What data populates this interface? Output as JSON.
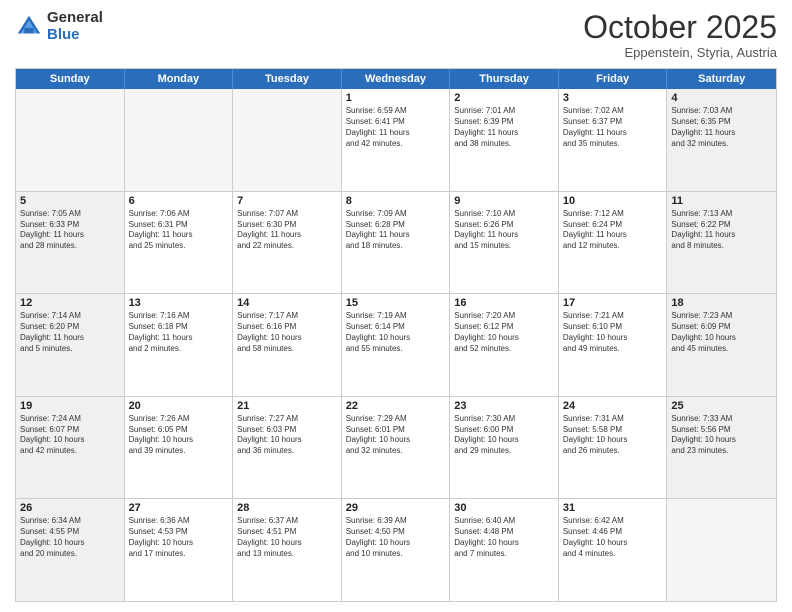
{
  "logo": {
    "general": "General",
    "blue": "Blue"
  },
  "header": {
    "month": "October 2025",
    "location": "Eppenstein, Styria, Austria"
  },
  "days": [
    "Sunday",
    "Monday",
    "Tuesday",
    "Wednesday",
    "Thursday",
    "Friday",
    "Saturday"
  ],
  "weeks": [
    [
      {
        "num": "",
        "text": "",
        "empty": true
      },
      {
        "num": "",
        "text": "",
        "empty": true
      },
      {
        "num": "",
        "text": "",
        "empty": true
      },
      {
        "num": "1",
        "text": "Sunrise: 6:59 AM\nSunset: 6:41 PM\nDaylight: 11 hours\nand 42 minutes.",
        "empty": false
      },
      {
        "num": "2",
        "text": "Sunrise: 7:01 AM\nSunset: 6:39 PM\nDaylight: 11 hours\nand 38 minutes.",
        "empty": false
      },
      {
        "num": "3",
        "text": "Sunrise: 7:02 AM\nSunset: 6:37 PM\nDaylight: 11 hours\nand 35 minutes.",
        "empty": false
      },
      {
        "num": "4",
        "text": "Sunrise: 7:03 AM\nSunset: 6:35 PM\nDaylight: 11 hours\nand 32 minutes.",
        "empty": false,
        "shaded": true
      }
    ],
    [
      {
        "num": "5",
        "text": "Sunrise: 7:05 AM\nSunset: 6:33 PM\nDaylight: 11 hours\nand 28 minutes.",
        "empty": false,
        "shaded": true
      },
      {
        "num": "6",
        "text": "Sunrise: 7:06 AM\nSunset: 6:31 PM\nDaylight: 11 hours\nand 25 minutes.",
        "empty": false
      },
      {
        "num": "7",
        "text": "Sunrise: 7:07 AM\nSunset: 6:30 PM\nDaylight: 11 hours\nand 22 minutes.",
        "empty": false
      },
      {
        "num": "8",
        "text": "Sunrise: 7:09 AM\nSunset: 6:28 PM\nDaylight: 11 hours\nand 18 minutes.",
        "empty": false
      },
      {
        "num": "9",
        "text": "Sunrise: 7:10 AM\nSunset: 6:26 PM\nDaylight: 11 hours\nand 15 minutes.",
        "empty": false
      },
      {
        "num": "10",
        "text": "Sunrise: 7:12 AM\nSunset: 6:24 PM\nDaylight: 11 hours\nand 12 minutes.",
        "empty": false
      },
      {
        "num": "11",
        "text": "Sunrise: 7:13 AM\nSunset: 6:22 PM\nDaylight: 11 hours\nand 8 minutes.",
        "empty": false,
        "shaded": true
      }
    ],
    [
      {
        "num": "12",
        "text": "Sunrise: 7:14 AM\nSunset: 6:20 PM\nDaylight: 11 hours\nand 5 minutes.",
        "empty": false,
        "shaded": true
      },
      {
        "num": "13",
        "text": "Sunrise: 7:16 AM\nSunset: 6:18 PM\nDaylight: 11 hours\nand 2 minutes.",
        "empty": false
      },
      {
        "num": "14",
        "text": "Sunrise: 7:17 AM\nSunset: 6:16 PM\nDaylight: 10 hours\nand 58 minutes.",
        "empty": false
      },
      {
        "num": "15",
        "text": "Sunrise: 7:19 AM\nSunset: 6:14 PM\nDaylight: 10 hours\nand 55 minutes.",
        "empty": false
      },
      {
        "num": "16",
        "text": "Sunrise: 7:20 AM\nSunset: 6:12 PM\nDaylight: 10 hours\nand 52 minutes.",
        "empty": false
      },
      {
        "num": "17",
        "text": "Sunrise: 7:21 AM\nSunset: 6:10 PM\nDaylight: 10 hours\nand 49 minutes.",
        "empty": false
      },
      {
        "num": "18",
        "text": "Sunrise: 7:23 AM\nSunset: 6:09 PM\nDaylight: 10 hours\nand 45 minutes.",
        "empty": false,
        "shaded": true
      }
    ],
    [
      {
        "num": "19",
        "text": "Sunrise: 7:24 AM\nSunset: 6:07 PM\nDaylight: 10 hours\nand 42 minutes.",
        "empty": false,
        "shaded": true
      },
      {
        "num": "20",
        "text": "Sunrise: 7:26 AM\nSunset: 6:05 PM\nDaylight: 10 hours\nand 39 minutes.",
        "empty": false
      },
      {
        "num": "21",
        "text": "Sunrise: 7:27 AM\nSunset: 6:03 PM\nDaylight: 10 hours\nand 36 minutes.",
        "empty": false
      },
      {
        "num": "22",
        "text": "Sunrise: 7:29 AM\nSunset: 6:01 PM\nDaylight: 10 hours\nand 32 minutes.",
        "empty": false
      },
      {
        "num": "23",
        "text": "Sunrise: 7:30 AM\nSunset: 6:00 PM\nDaylight: 10 hours\nand 29 minutes.",
        "empty": false
      },
      {
        "num": "24",
        "text": "Sunrise: 7:31 AM\nSunset: 5:58 PM\nDaylight: 10 hours\nand 26 minutes.",
        "empty": false
      },
      {
        "num": "25",
        "text": "Sunrise: 7:33 AM\nSunset: 5:56 PM\nDaylight: 10 hours\nand 23 minutes.",
        "empty": false,
        "shaded": true
      }
    ],
    [
      {
        "num": "26",
        "text": "Sunrise: 6:34 AM\nSunset: 4:55 PM\nDaylight: 10 hours\nand 20 minutes.",
        "empty": false,
        "shaded": true
      },
      {
        "num": "27",
        "text": "Sunrise: 6:36 AM\nSunset: 4:53 PM\nDaylight: 10 hours\nand 17 minutes.",
        "empty": false
      },
      {
        "num": "28",
        "text": "Sunrise: 6:37 AM\nSunset: 4:51 PM\nDaylight: 10 hours\nand 13 minutes.",
        "empty": false
      },
      {
        "num": "29",
        "text": "Sunrise: 6:39 AM\nSunset: 4:50 PM\nDaylight: 10 hours\nand 10 minutes.",
        "empty": false
      },
      {
        "num": "30",
        "text": "Sunrise: 6:40 AM\nSunset: 4:48 PM\nDaylight: 10 hours\nand 7 minutes.",
        "empty": false
      },
      {
        "num": "31",
        "text": "Sunrise: 6:42 AM\nSunset: 4:46 PM\nDaylight: 10 hours\nand 4 minutes.",
        "empty": false
      },
      {
        "num": "",
        "text": "",
        "empty": true,
        "shaded": true
      }
    ]
  ]
}
